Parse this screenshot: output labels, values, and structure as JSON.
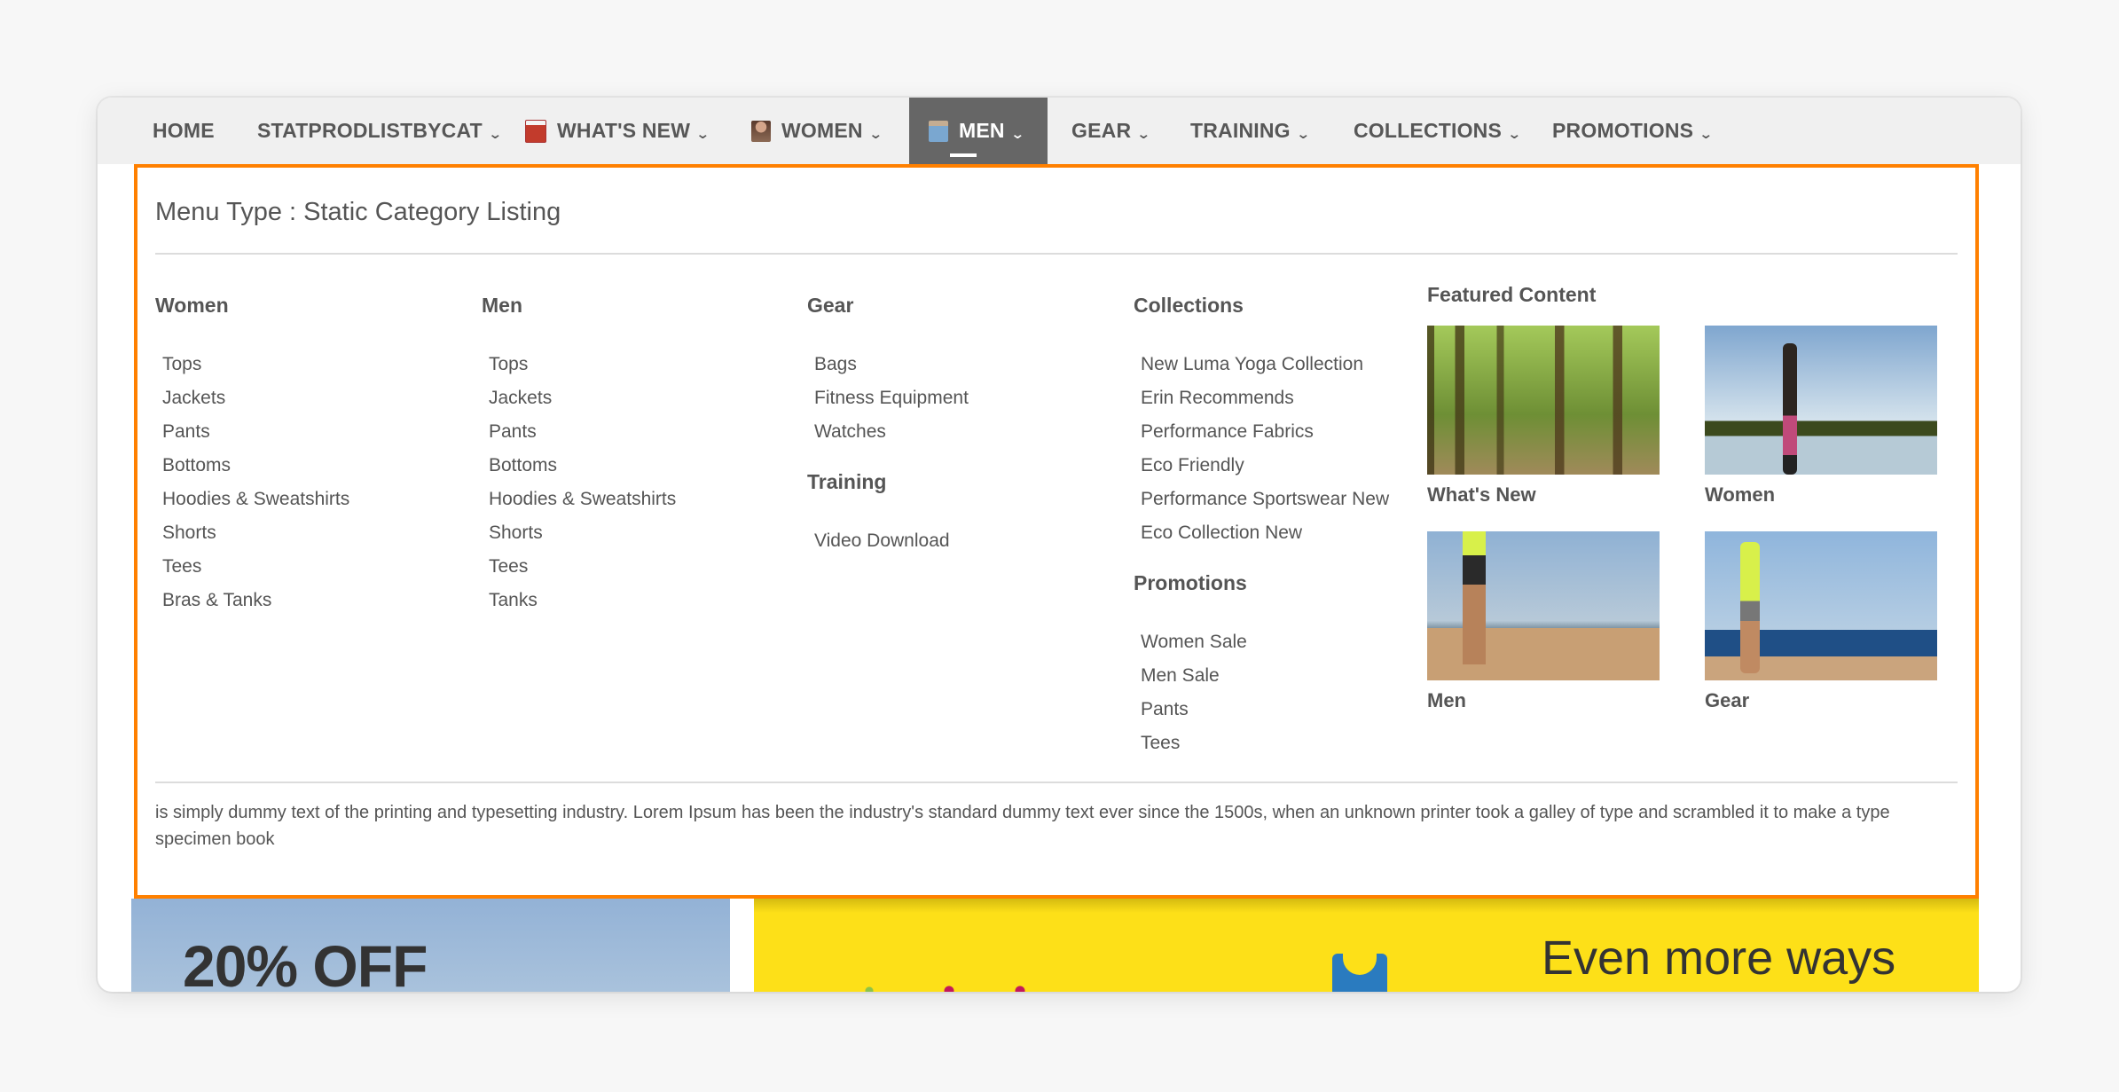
{
  "nav": {
    "items": [
      {
        "label": "HOME",
        "icon": null,
        "has_dropdown": false
      },
      {
        "label": "STATPRODLISTBYCAT",
        "icon": null,
        "has_dropdown": true
      },
      {
        "label": "WHAT'S NEW",
        "icon": "basket-icon",
        "has_dropdown": true
      },
      {
        "label": "WOMEN",
        "icon": "woman-icon",
        "has_dropdown": true
      },
      {
        "label": "MEN",
        "icon": "man-icon",
        "has_dropdown": true,
        "active": true
      },
      {
        "label": "GEAR",
        "icon": null,
        "has_dropdown": true
      },
      {
        "label": "TRAINING",
        "icon": null,
        "has_dropdown": true
      },
      {
        "label": "COLLECTIONS",
        "icon": null,
        "has_dropdown": true
      },
      {
        "label": "PROMOTIONS",
        "icon": null,
        "has_dropdown": true
      }
    ],
    "chevron": "⌄",
    "active_bg": "#666666"
  },
  "dropdown": {
    "title": "Menu Type : Static Category Listing",
    "border_color": "#ff8000",
    "columns": [
      {
        "heading": "Women",
        "items": [
          "Tops",
          "Jackets",
          "Pants",
          "Bottoms",
          "Hoodies & Sweatshirts",
          "Shorts",
          "Tees",
          "Bras & Tanks"
        ]
      },
      {
        "heading": "Men",
        "items": [
          "Tops",
          "Jackets",
          "Pants",
          "Bottoms",
          "Hoodies & Sweatshirts",
          "Shorts",
          "Tees",
          "Tanks"
        ]
      },
      {
        "heading": "Gear",
        "items": [
          "Bags",
          "Fitness Equipment",
          "Watches"
        ],
        "heading2": "Training",
        "items2": [
          "Video Download"
        ]
      },
      {
        "heading": "Collections",
        "items": [
          "New Luma Yoga Collection",
          "Erin Recommends",
          "Performance Fabrics",
          "Eco Friendly",
          "Performance Sportswear New",
          "Eco Collection New"
        ],
        "heading2": "Promotions",
        "items2": [
          "Women Sale",
          "Men Sale",
          "Pants",
          "Tees"
        ]
      }
    ],
    "featured": {
      "heading": "Featured Content",
      "cards": [
        {
          "caption": "What's New",
          "image": "forest-trail-photo"
        },
        {
          "caption": "Women",
          "image": "yoga-lake-photo"
        },
        {
          "caption": "Men",
          "image": "beach-runner-photo"
        },
        {
          "caption": "Gear",
          "image": "beach-stretch-photo"
        }
      ]
    },
    "footer_text": "is simply dummy text of the printing and typesetting industry. Lorem Ipsum has been the industry's standard dummy text ever since the 1500s, when an unknown printer took a galley of type and scrambled it to make a type specimen book"
  },
  "banners": {
    "left_text": "20% OFF",
    "right_text": "Even more ways",
    "right_bg": "#fde018"
  }
}
